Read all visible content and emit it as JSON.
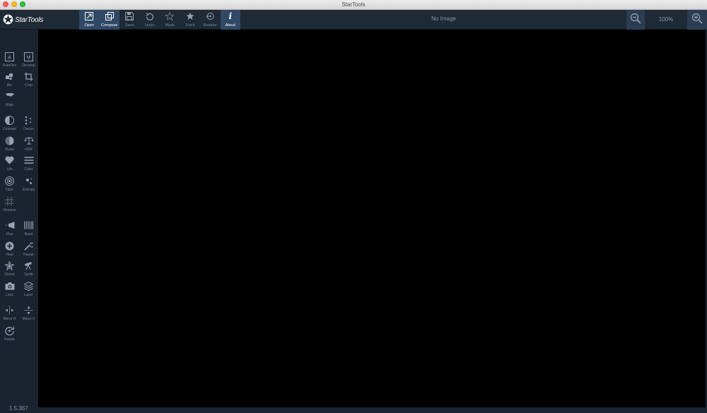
{
  "window": {
    "title": "StarTools"
  },
  "logo": {
    "text": "StarTools"
  },
  "toolbar": {
    "buttons": [
      {
        "label": "Open",
        "icon": "open-icon"
      },
      {
        "label": "Compose",
        "icon": "compose-icon"
      },
      {
        "label": "Save",
        "icon": "save-icon"
      },
      {
        "label": "Undo",
        "icon": "undo-icon"
      },
      {
        "label": "Mask",
        "icon": "mask-icon"
      },
      {
        "label": "Track",
        "icon": "track-icon"
      },
      {
        "label": "Restore",
        "icon": "restore-icon"
      },
      {
        "label": "About",
        "icon": "info-icon"
      }
    ],
    "status": "No Image",
    "zoom": "100%"
  },
  "sidebar": {
    "tools": [
      {
        "label": "AutoDev",
        "icon": "autodev-icon"
      },
      {
        "label": "Develop",
        "icon": "develop-icon"
      },
      {
        "label": "Bin",
        "icon": "bin-icon"
      },
      {
        "label": "Crop",
        "icon": "crop-icon"
      },
      {
        "label": "Wipe",
        "icon": "wipe-icon"
      },
      {
        "label": "Contrast",
        "icon": "contrast-icon"
      },
      {
        "label": "Decon",
        "icon": "decon-icon"
      },
      {
        "label": "Sharp",
        "icon": "sharp-icon"
      },
      {
        "label": "HDR",
        "icon": "hdr-icon"
      },
      {
        "label": "Life",
        "icon": "life-icon"
      },
      {
        "label": "Color",
        "icon": "color-icon"
      },
      {
        "label": "Filter",
        "icon": "filter-icon"
      },
      {
        "label": "Entropy",
        "icon": "entropy-icon"
      },
      {
        "label": "Denoise",
        "icon": "denoise-icon"
      },
      {
        "label": "Flux",
        "icon": "flux-icon"
      },
      {
        "label": "Band",
        "icon": "band-icon"
      },
      {
        "label": "Heal",
        "icon": "heal-icon"
      },
      {
        "label": "Repair",
        "icon": "repair-icon"
      },
      {
        "label": "Shrink",
        "icon": "shrink-icon"
      },
      {
        "label": "Synth",
        "icon": "synth-icon"
      },
      {
        "label": "Lens",
        "icon": "lens-icon"
      },
      {
        "label": "Layer",
        "icon": "layer-icon"
      },
      {
        "label": "Mirror H",
        "icon": "mirror-h-icon"
      },
      {
        "label": "Mirror V",
        "icon": "mirror-v-icon"
      },
      {
        "label": "Rotate",
        "icon": "rotate-icon"
      }
    ]
  },
  "version": "1.5.367",
  "colors": {
    "toolbar_bg": "#1f2a37",
    "active_bg": "#2f4966",
    "canvas_bg": "#000000",
    "icon": "#97a3b1"
  }
}
